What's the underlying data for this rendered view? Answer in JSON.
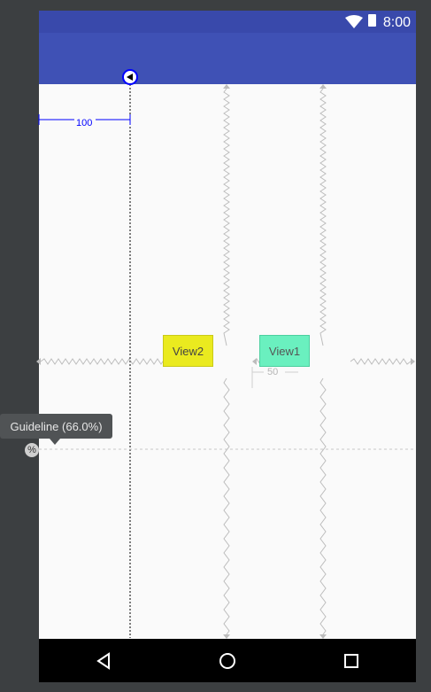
{
  "status_bar": {
    "time": "8:00"
  },
  "guideline": {
    "margin_label": "100",
    "tooltip": "Guideline (66.0%)",
    "percent_toggle": "%"
  },
  "views": {
    "view2": {
      "label": "View2"
    },
    "view1": {
      "label": "View1"
    },
    "gap_label": "50"
  },
  "colors": {
    "status_bar": "#3949ab",
    "app_bar": "#3f51b5",
    "view2": "#eaea1f",
    "view1": "#6af0bf",
    "guideline": "#0000ff"
  },
  "nav": {
    "back_icon": "back-triangle-icon",
    "home_icon": "home-circle-icon",
    "recents_icon": "recents-square-icon"
  }
}
